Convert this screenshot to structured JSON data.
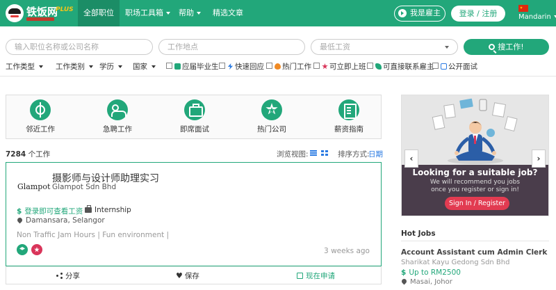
{
  "nav": {
    "logo_text": "铁饭网",
    "logo_plus": "PLUS",
    "items": [
      {
        "label": "全部职位"
      },
      {
        "label": "职场工具箱"
      },
      {
        "label": "帮助"
      },
      {
        "label": "精选文章"
      }
    ],
    "employer_label": "我是雇主",
    "login_label": "登录 / 注册",
    "language": "Mandarin"
  },
  "search": {
    "keyword_placeholder": "输入职位名称或公司名称",
    "location_placeholder": "工作地点",
    "salary_placeholder": "最低工资",
    "button_label": "搜工作!"
  },
  "filters": {
    "dropdowns": [
      "工作类型",
      "工作类别",
      "学历",
      "国家"
    ],
    "tags": [
      {
        "label": "应届毕业生",
        "icon": "graduate-icon",
        "color": "#22a77a"
      },
      {
        "label": "快速回应",
        "icon": "lightning-icon",
        "color": "#2a7ae2"
      },
      {
        "label": "热门工作",
        "icon": "fire-icon",
        "color": "#f08a24"
      },
      {
        "label": "可立即上班",
        "icon": "star-icon",
        "color": "#d9355a"
      },
      {
        "label": "可直接联系雇主",
        "icon": "phone-icon",
        "color": "#22a77a"
      },
      {
        "label": "公开面试",
        "icon": "calendar-icon",
        "color": "#2a7ae2"
      }
    ]
  },
  "categories": [
    {
      "label": "邻近工作",
      "icon": "crosshair-icon"
    },
    {
      "label": "急聘工作",
      "icon": "people-icon"
    },
    {
      "label": "即席面试",
      "icon": "briefcase-icon"
    },
    {
      "label": "热门公司",
      "icon": "star-icon"
    },
    {
      "label": "薪资指南",
      "icon": "document-icon"
    }
  ],
  "results": {
    "count": "7284",
    "count_suffix": "个工作",
    "view_label": "浏览视图:",
    "sort_label": "排序方式:",
    "sort_value": "日期"
  },
  "job": {
    "company_logo": "Glampot",
    "title": "摄影师与设计师助理实习",
    "company": "Glampot Sdn Bhd",
    "salary": "登录即可查看工资",
    "type": "Internship",
    "location": "Damansara, Selangor",
    "tags": "Non Traffic Jam Hours | Fun environment  |",
    "posted": "3 weeks ago",
    "share_label": "分享",
    "save_label": "保存",
    "apply_label": "现在申请"
  },
  "ad": {
    "title": "Looking for a suitable job?",
    "text": "We will recommend you jobs once you register or sign in!",
    "button": "Sign In / Register"
  },
  "hot_jobs": {
    "heading": "Hot Jobs",
    "items": [
      {
        "title": "Account Assistant cum Admin Clerk",
        "company": "Sharikat Kayu Gedong Sdn Bhd",
        "salary": "Up to RM2500",
        "location": "Masai, Johor"
      }
    ]
  },
  "colors": {
    "brand": "#22a77a",
    "link": "#2a7ae2",
    "ad_button": "#e23b51"
  }
}
